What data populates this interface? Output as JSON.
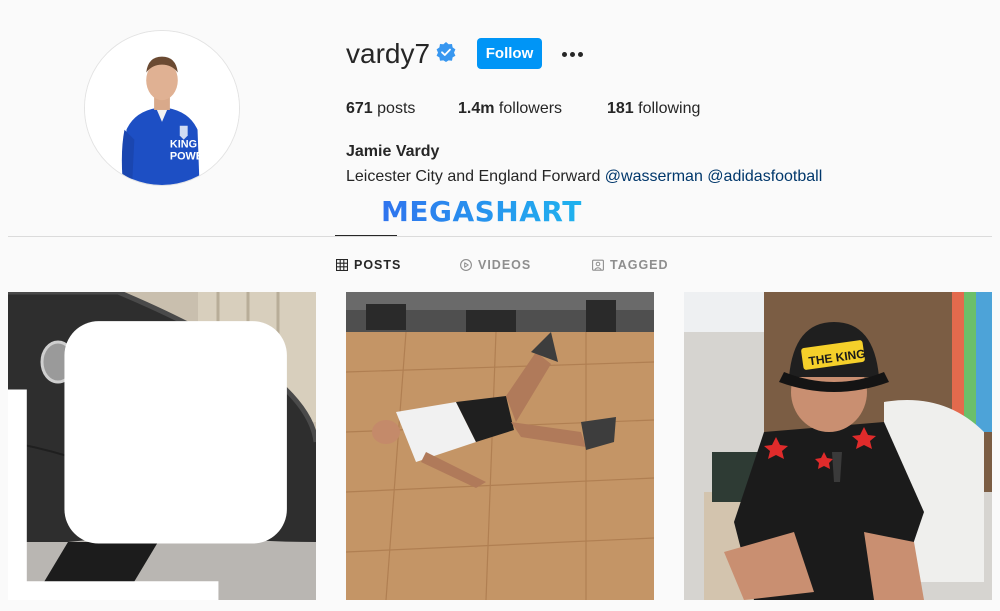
{
  "profile": {
    "username": "vardy7",
    "follow_label": "Follow",
    "full_name": "Jamie Vardy",
    "bio_text": "Leicester City and England Forward ",
    "bio_mention_1": "@wasserman",
    "bio_mention_2": "@adidasfootball",
    "avatar_shirt_text_1": "KING",
    "avatar_shirt_text_2": "POWE"
  },
  "stats": {
    "posts_count": "671",
    "posts_label": " posts",
    "followers_count": "1.4m",
    "followers_label": " followers",
    "following_count": "181",
    "following_label": " following"
  },
  "watermark": {
    "text": "MEGASHART"
  },
  "tabs": [
    {
      "label": "POSTS",
      "icon": "grid-icon",
      "active": true
    },
    {
      "label": "VIDEOS",
      "icon": "play-circle-icon",
      "active": false
    },
    {
      "label": "TAGGED",
      "icon": "tag-icon",
      "active": false
    }
  ],
  "posts": [
    {
      "description": "hyperbaric-chamber-photo",
      "multiple": true
    },
    {
      "description": "floor-exercise-photo",
      "multiple": false
    },
    {
      "description": "the-king-cap-photo",
      "multiple": false,
      "cap_text": "THE KING"
    }
  ],
  "colors": {
    "accent": "#0095f6",
    "verified": "#3897f0",
    "link": "#00376b"
  }
}
